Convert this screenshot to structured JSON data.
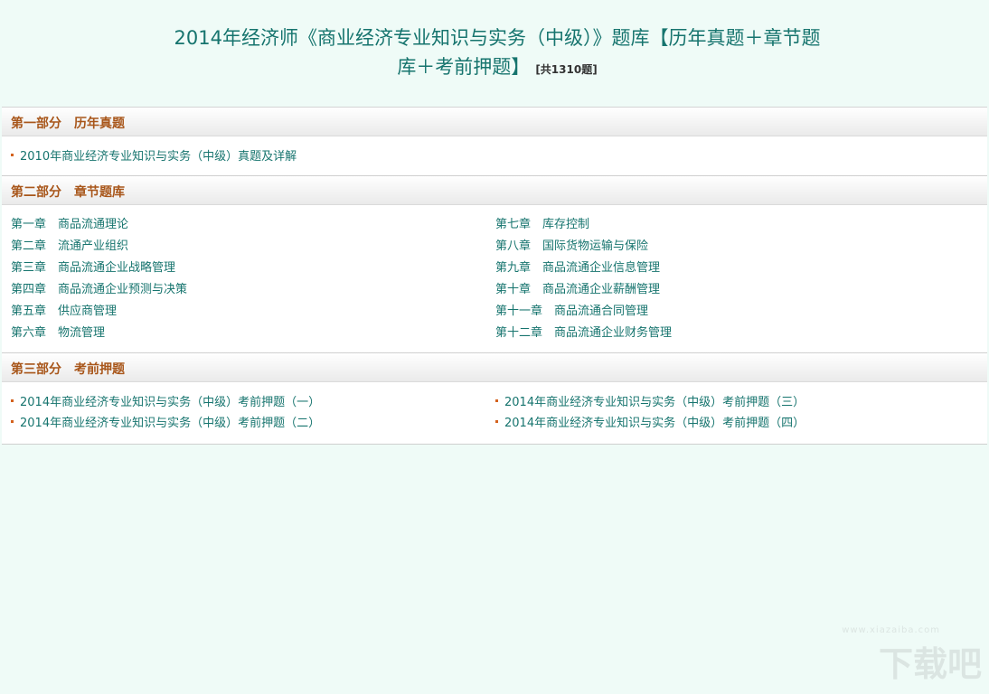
{
  "header": {
    "title_line1": "2014年经济师《商业经济专业知识与实务（中级）》题库【历年真题＋章节题",
    "title_line2": "库＋考前押题】",
    "count": "[共1310题]"
  },
  "section1": {
    "title": "第一部分　历年真题",
    "items": [
      "2010年商业经济专业知识与实务（中级）真题及详解"
    ]
  },
  "section2": {
    "title": "第二部分　章节题库",
    "left": [
      "第一章　商品流通理论",
      "第二章　流通产业组织",
      "第三章　商品流通企业战略管理",
      "第四章　商品流通企业预测与决策",
      "第五章　供应商管理",
      "第六章　物流管理"
    ],
    "right": [
      "第七章　库存控制",
      "第八章　国际货物运输与保险",
      "第九章　商品流通企业信息管理",
      "第十章　商品流通企业薪酬管理",
      "第十一章　商品流通合同管理",
      "第十二章　商品流通企业财务管理"
    ]
  },
  "section3": {
    "title": "第三部分　考前押题",
    "left": [
      "2014年商业经济专业知识与实务（中级）考前押题（一）",
      "2014年商业经济专业知识与实务（中级）考前押题（二）"
    ],
    "right": [
      "2014年商业经济专业知识与实务（中级）考前押题（三）",
      "2014年商业经济专业知识与实务（中级）考前押题（四）"
    ]
  },
  "watermark": {
    "brand": "下载吧",
    "url": "www.xiazaiba.com"
  }
}
